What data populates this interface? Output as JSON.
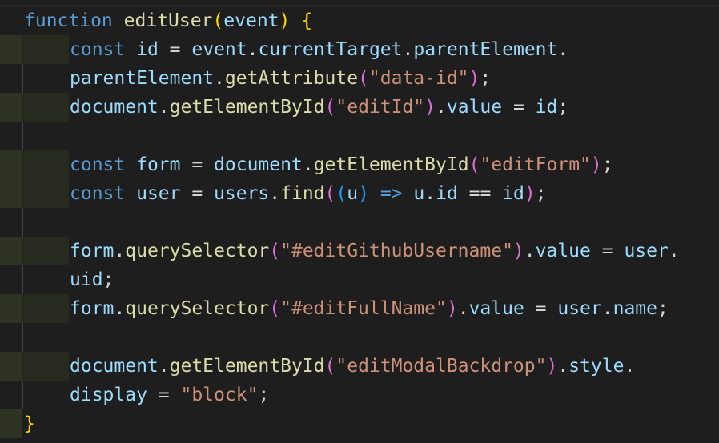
{
  "editor": {
    "language": "javascript",
    "colors": {
      "background": "#1e1e1e",
      "keyword": "#569cd6",
      "function": "#dcdcaa",
      "variable": "#9cdcfe",
      "string": "#ce9178",
      "brace": "#ffd700",
      "paren_level2": "#da70d6",
      "paren_level3": "#179fff"
    },
    "lines": [
      "function editUser(event) {",
      "const id = event.currentTarget.parentElement.",
      "parentElement.getAttribute(\"data-id\");",
      "document.getElementById(\"editId\").value = id;",
      "",
      "const form = document.getElementById(\"editForm\");",
      "const user = users.find((u) => u.id == id);",
      "",
      "form.querySelector(\"#editGithubUsername\").value = user.",
      "uid;",
      "form.querySelector(\"#editFullName\").value = user.name;",
      "",
      "document.getElementById(\"editModalBackdrop\").style.",
      "display = \"block\";",
      "}"
    ],
    "tokens": {
      "l1": {
        "kw": "function",
        "fn": "editUser",
        "p1": "(",
        "arg": "event",
        "p2": ")",
        "sp": " ",
        "brace": "{"
      },
      "l2": {
        "kw": "const",
        "var": "id",
        "eq": " = ",
        "obj": "event",
        "dot1": ".",
        "prop1": "currentTarget",
        "dot2": ".",
        "prop2": "parentElement",
        "dot3": "."
      },
      "l3": {
        "prop": "parentElement",
        "dot": ".",
        "fn": "getAttribute",
        "p1": "(",
        "str": "\"data-id\"",
        "p2": ")",
        "semi": ";"
      },
      "l4": {
        "obj": "document",
        "dot": ".",
        "fn": "getElementById",
        "p1": "(",
        "str": "\"editId\"",
        "p2": ")",
        "dot2": ".",
        "prop": "value",
        "eq": " = ",
        "var": "id",
        "semi": ";"
      },
      "l6": {
        "kw": "const",
        "var": "form",
        "eq": " = ",
        "obj": "document",
        "dot": ".",
        "fn": "getElementById",
        "p1": "(",
        "str": "\"editForm\"",
        "p2": ")",
        "semi": ";"
      },
      "l7": {
        "kw": "const",
        "var": "user",
        "eq": " = ",
        "obj": "users",
        "dot": ".",
        "fn": "find",
        "p1": "(",
        "p2": "(",
        "arg": "u",
        "p3": ")",
        "arrow": " => ",
        "obj2": "u",
        "dot2": ".",
        "prop": "id",
        "cmp": " == ",
        "var2": "id",
        "p4": ")",
        "semi": ";"
      },
      "l9": {
        "obj": "form",
        "dot": ".",
        "fn": "querySelector",
        "p1": "(",
        "str": "\"#editGithubUsername\"",
        "p2": ")",
        "dot2": ".",
        "prop": "value",
        "eq": " = ",
        "var": "user",
        "dot3": "."
      },
      "l10": {
        "prop": "uid",
        "semi": ";"
      },
      "l11": {
        "obj": "form",
        "dot": ".",
        "fn": "querySelector",
        "p1": "(",
        "str": "\"#editFullName\"",
        "p2": ")",
        "dot2": ".",
        "prop": "value",
        "eq": " = ",
        "var": "user",
        "dot3": ".",
        "prop2": "name",
        "semi": ";"
      },
      "l13": {
        "obj": "document",
        "dot": ".",
        "fn": "getElementById",
        "p1": "(",
        "str": "\"editModalBackdrop\"",
        "p2": ")",
        "dot2": ".",
        "prop": "style",
        "dot3": "."
      },
      "l14": {
        "prop": "display",
        "eq": " = ",
        "str": "\"block\"",
        "semi": ";"
      },
      "l15": {
        "brace": "}"
      }
    }
  }
}
